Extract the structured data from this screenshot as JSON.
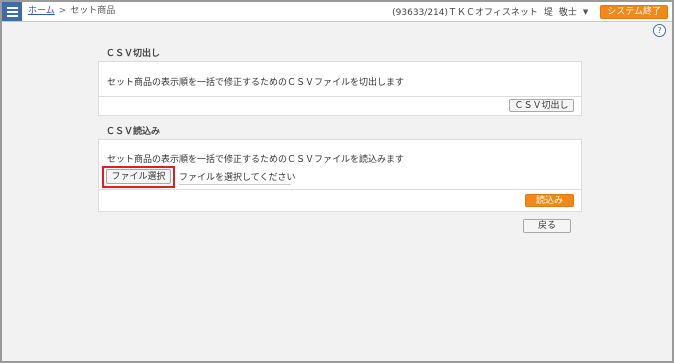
{
  "header": {
    "breadcrumb_home": "ホーム",
    "breadcrumb_sep": ">",
    "breadcrumb_current": "セット商品",
    "office": "(93633/214)ＴＫＣオフィスネット",
    "user_last": "堤",
    "user_first": "敬士",
    "user_caret": "▼",
    "exit_label": "システム終了",
    "help": "?"
  },
  "export": {
    "title": "ＣＳＶ切出し",
    "description": "セット商品の表示順を一括で修正するためのＣＳＶファイルを切出します",
    "button": "ＣＳＶ切出し"
  },
  "import": {
    "title": "ＣＳＶ読込み",
    "description": "セット商品の表示順を一括で修正するためのＣＳＶファイルを読込みます",
    "file_button": "ファイル選択",
    "file_placeholder": "ファイルを選択してください",
    "submit": "読込み"
  },
  "footer": {
    "back": "戻る"
  },
  "colors": {
    "accent_orange": "#f0891a",
    "menu_blue": "#3b6ea8",
    "highlight_red": "#e02020"
  }
}
